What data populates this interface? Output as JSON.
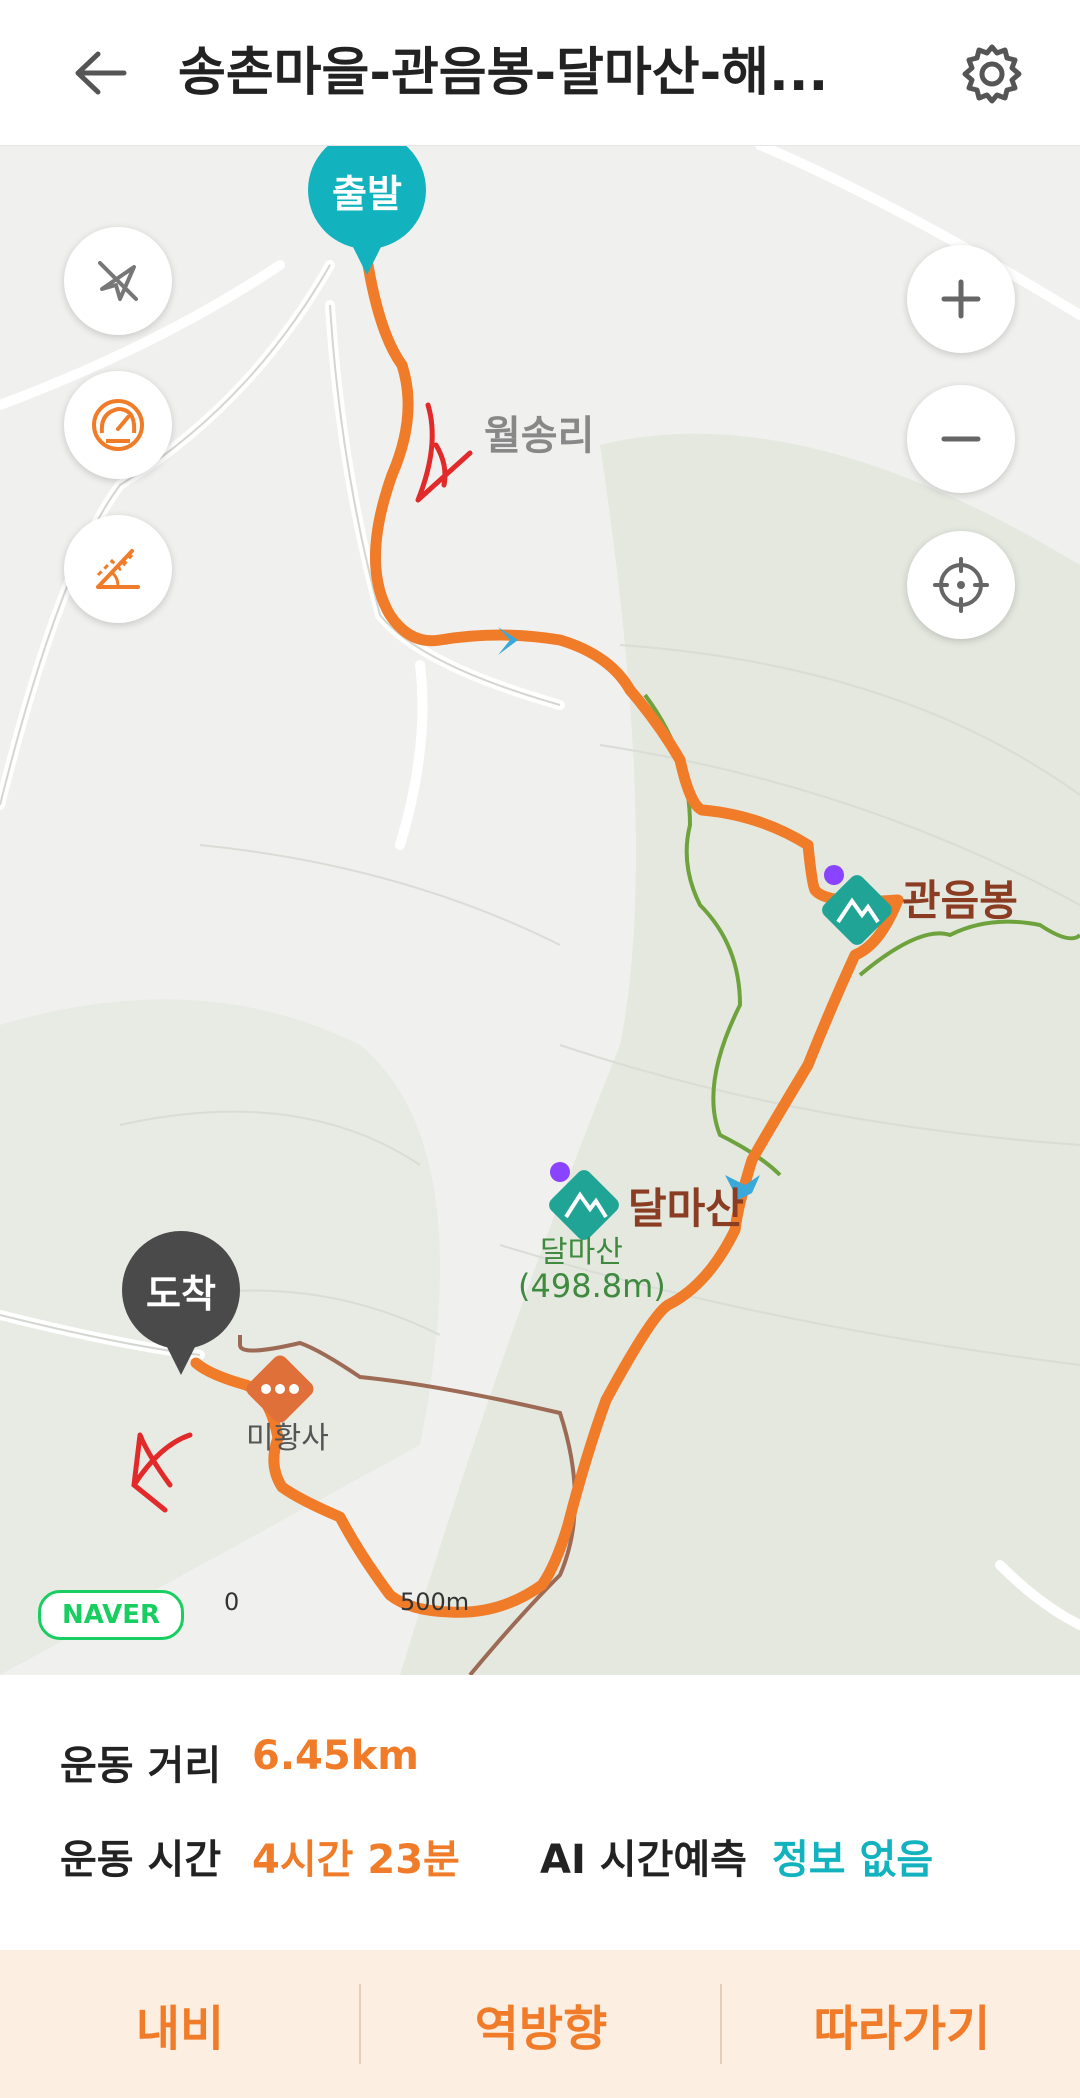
{
  "header": {
    "title": "송촌마을-관음봉-달마산-해...",
    "back_icon": "arrow-left-icon",
    "settings_icon": "gear-icon"
  },
  "map": {
    "start_label": "출발",
    "end_label": "도착",
    "place_labels": {
      "village": "월송리",
      "peak1": "관음봉",
      "peak2": "달마산",
      "peak2_small": "달마산",
      "peak2_height": "(498.8m)",
      "temple": "미황사"
    },
    "controls": {
      "compass_icon": "compass-off-icon",
      "speed_icon": "speedometer-icon",
      "slope_icon": "slope-icon",
      "zoom_in_icon": "plus-icon",
      "zoom_out_icon": "minus-icon",
      "locate_icon": "crosshair-icon"
    },
    "brand": "NAVER",
    "scale": {
      "start": "0",
      "end": "500m"
    }
  },
  "info": {
    "distance_label": "운동 거리",
    "distance_value": "6.45km",
    "time_label": "운동 시간",
    "time_value": "4시간 23분",
    "ai_label": "AI 시간예측",
    "ai_value": "정보 없음"
  },
  "bottom_bar": {
    "nav": "내비",
    "reverse": "역방향",
    "follow": "따라가기"
  },
  "colors": {
    "route": "#f07c2a",
    "teal": "#12b3bf",
    "trail": "#6ea23d",
    "road": "#8a5a44"
  }
}
